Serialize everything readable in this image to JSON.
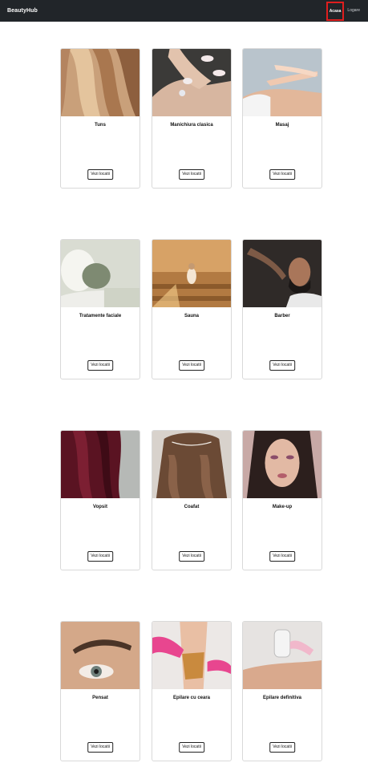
{
  "navbar": {
    "brand": "BeautyHub",
    "links": [
      "Acasa",
      "Logare"
    ]
  },
  "services": [
    {
      "title": "Tuns",
      "button": "Vezi locatii",
      "image": "hair-photo"
    },
    {
      "title": "Manichiura clasica",
      "button": "Vezi locatii",
      "image": "manicure-photo"
    },
    {
      "title": "Masaj",
      "button": "Vezi locatii",
      "image": "massage-photo"
    },
    {
      "title": "Tratamente faciale",
      "button": "Vezi locatii",
      "image": "facial-mask-photo"
    },
    {
      "title": "Sauna",
      "button": "Vezi locatii",
      "image": "sauna-photo"
    },
    {
      "title": "Barber",
      "button": "Vezi locatii",
      "image": "barber-photo"
    },
    {
      "title": "Vopsit",
      "button": "Vezi locatii",
      "image": "dyed-hair-photo"
    },
    {
      "title": "Coafat",
      "button": "Vezi locatii",
      "image": "curled-hair-photo"
    },
    {
      "title": "Make-up",
      "button": "Vezi locatii",
      "image": "makeup-photo"
    },
    {
      "title": "Pensat",
      "button": "Vezi locatii",
      "image": "eyebrow-photo"
    },
    {
      "title": "Epilare cu ceara",
      "button": "Vezi locatii",
      "image": "waxing-photo"
    },
    {
      "title": "Epilare definitiva",
      "button": "Vezi locatii",
      "image": "laser-hair-removal-photo"
    }
  ]
}
